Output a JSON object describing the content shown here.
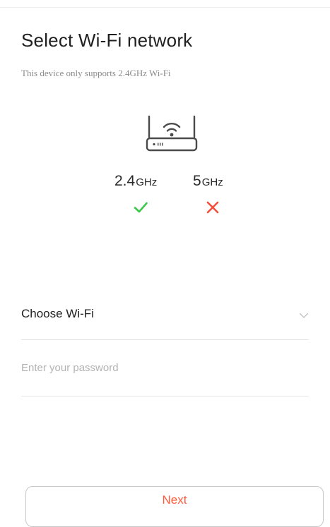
{
  "page": {
    "title": "Select Wi-Fi network",
    "subtitle": "This device only supports 2.4GHz Wi-Fi"
  },
  "router": {
    "icon": "router-wifi-icon"
  },
  "bands": [
    {
      "value": "2.4",
      "unit": "GHz",
      "supported": true,
      "status_icon": "check-icon",
      "status_color": "#3cc64a"
    },
    {
      "value": "5",
      "unit": "GHz",
      "supported": false,
      "status_icon": "cross-icon",
      "status_color": "#f0503a"
    }
  ],
  "form": {
    "wifi_label": "Choose Wi-Fi",
    "wifi_icon": "chevron-down-icon",
    "password_placeholder": "Enter your password",
    "password_value": ""
  },
  "actions": {
    "next_label": "Next"
  },
  "colors": {
    "accent": "#ff5a3c",
    "text": "#1f1f1f",
    "muted": "#8c8c8c",
    "placeholder": "#b3b3b3",
    "divider": "#e5e5e5"
  }
}
